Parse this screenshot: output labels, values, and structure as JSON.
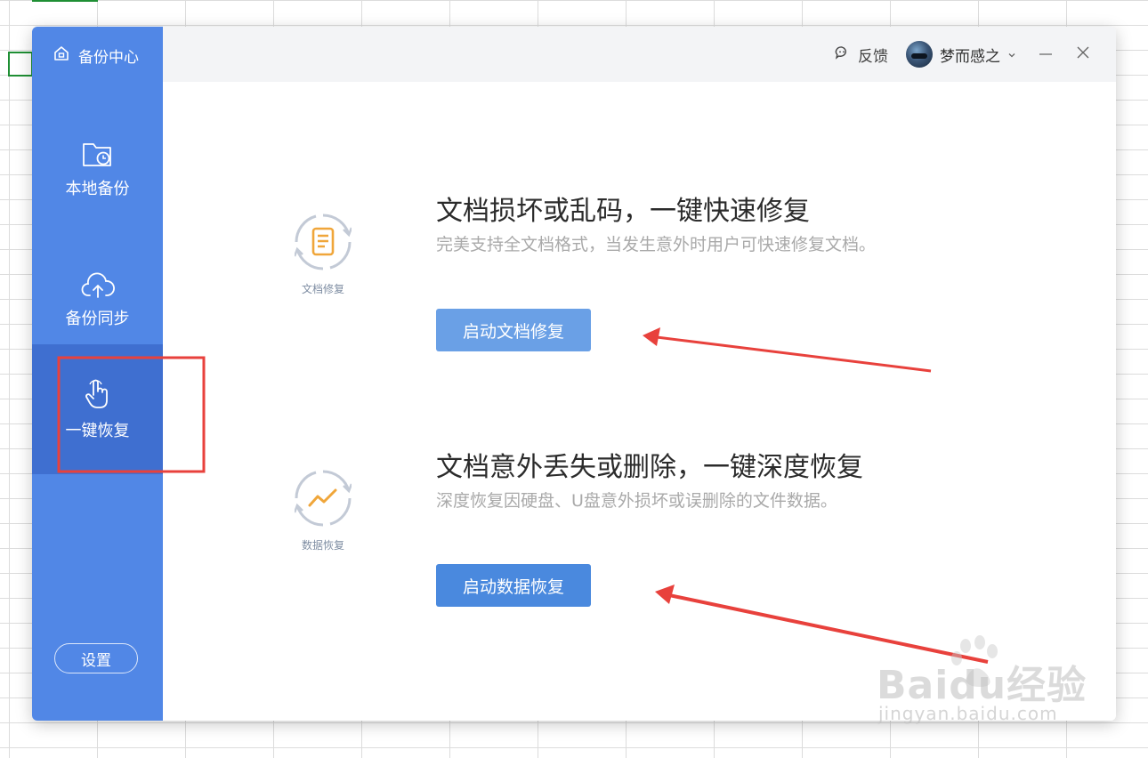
{
  "sidebar": {
    "title": "备份中心",
    "items": [
      {
        "label": "本地备份"
      },
      {
        "label": "备份同步"
      },
      {
        "label": "一键恢复"
      }
    ],
    "settings_label": "设置",
    "color": "#5187e6",
    "active_color": "#3f6fd0"
  },
  "titlebar": {
    "feedback_label": "反馈",
    "username": "梦而感之"
  },
  "sections": [
    {
      "icon_caption": "文档修复",
      "title": "文档损坏或乱码，一键快速修复",
      "description": "完美支持全文档格式，当发生意外时用户可快速修复文档。",
      "button_label": "启动文档修复"
    },
    {
      "icon_caption": "数据恢复",
      "title": "文档意外丢失或删除，一键深度恢复",
      "description": "深度恢复因硬盘、U盘意外损坏或误删除的文件数据。",
      "button_label": "启动数据恢复"
    }
  ],
  "watermark": {
    "main": "Baidu经验",
    "sub": "jingyan.baidu.com"
  },
  "colors": {
    "annotation_red": "#e8413c",
    "accent_orange": "#f0a63a"
  }
}
